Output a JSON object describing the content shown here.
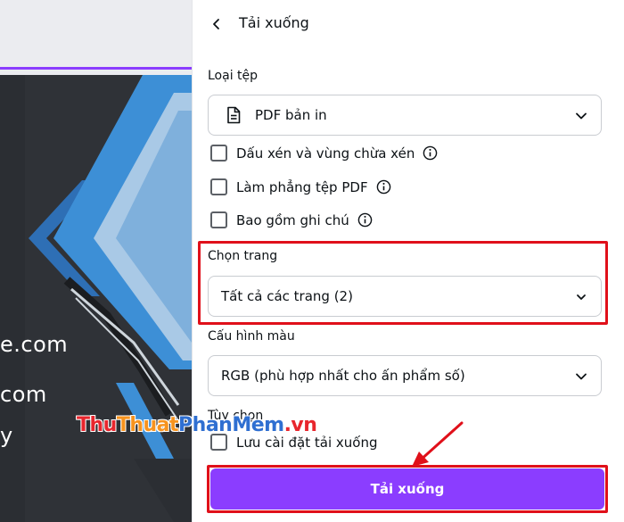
{
  "panel": {
    "title": "Tải xuống",
    "file_type_label": "Loại tệp",
    "file_type_value": "PDF bản in",
    "options": [
      {
        "label": "Dấu xén và vùng chừa xén",
        "checked": false
      },
      {
        "label": "Làm phẳng tệp PDF",
        "checked": false
      },
      {
        "label": "Bao gồm ghi chú",
        "checked": false
      }
    ],
    "pages_label": "Chọn trang",
    "pages_value": "Tất cả các trang (2)",
    "color_label": "Cấu hình màu",
    "color_value": "RGB (phù hợp nhất cho ấn phẩm số)",
    "more_label": "Tùy chọn",
    "save_settings_label": "Lưu cài đặt tải xuống",
    "download_button": "Tải xuống"
  },
  "canvas": {
    "text_lines": [
      "e.com",
      "com",
      "y"
    ]
  },
  "watermark": {
    "part1": "Thu",
    "part2": "Thuat",
    "part3": "PhanMem",
    "part4": ".vn"
  },
  "colors": {
    "accent": "#8b3dff",
    "highlight": "#e0101a",
    "design_bg": "#2f3237",
    "design_blue": "#3d8fd6"
  },
  "icons": [
    "back-arrow-icon",
    "document-icon",
    "chevron-down-icon",
    "info-icon"
  ]
}
